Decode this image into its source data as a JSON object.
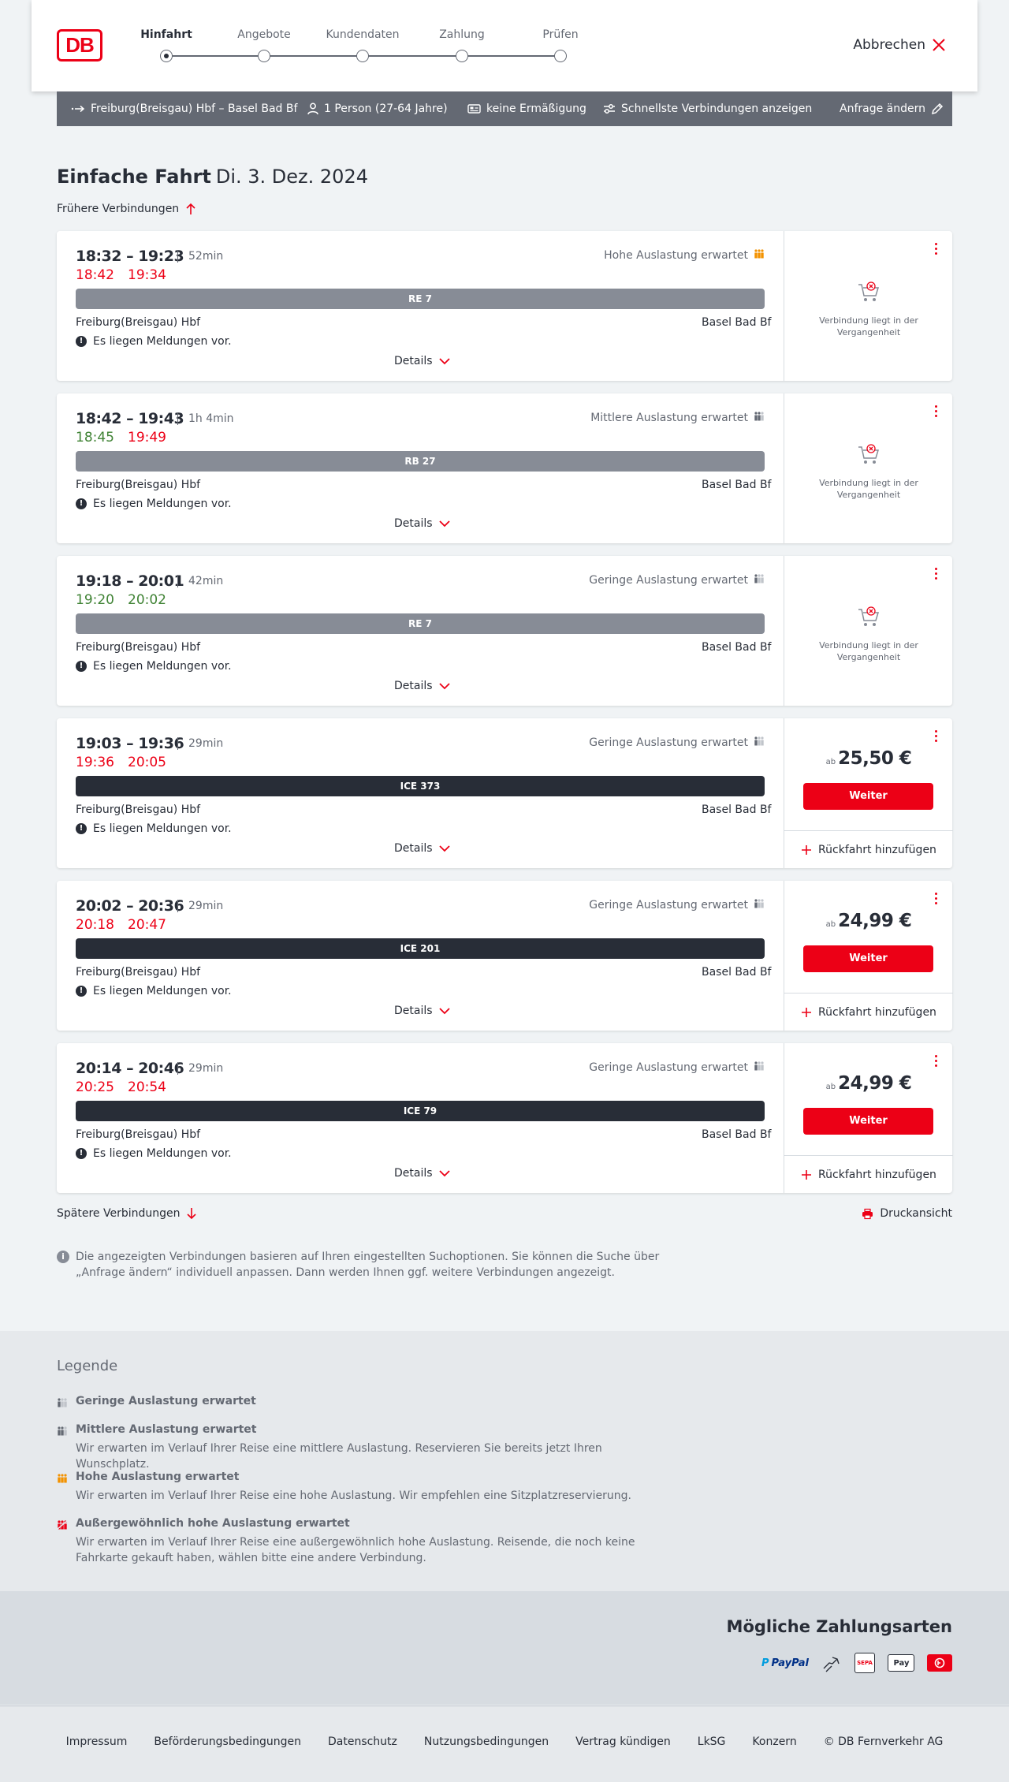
{
  "header": {
    "logo_text": "DB",
    "steps": [
      {
        "label": "Hinfahrt",
        "active": true
      },
      {
        "label": "Angebote",
        "active": false
      },
      {
        "label": "Kundendaten",
        "active": false
      },
      {
        "label": "Zahlung",
        "active": false
      },
      {
        "label": "Prüfen",
        "active": false
      }
    ],
    "cancel_label": "Abbrechen"
  },
  "summary": {
    "route": "Freiburg(Breisgau) Hbf – Basel Bad Bf",
    "passengers": "1 Person (27-64 Jahre)",
    "discount": "keine Ermäßigung",
    "fastest": "Schnellste Verbindungen anzeigen",
    "edit": "Anfrage ändern"
  },
  "main": {
    "title": "Einfache Fahrt",
    "date": "Di. 3. Dez. 2024",
    "earlier": "Frühere Verbindungen",
    "later": "Spätere Verbindungen",
    "print": "Druckansicht",
    "note": "Die angezeigten Verbindungen basieren auf Ihren eingestellten Suchoptionen. Sie können die Suche über „Anfrage ändern“ individuell anpassen. Dann werden Ihnen ggf. weitere Verbindungen angezeigt."
  },
  "connections": [
    {
      "times": "18:32 – 19:23",
      "duration": "52min",
      "rt_dep": "18:42",
      "rt_arr": "19:34",
      "rt_color": "red",
      "load": "Hohe Auslastung erwartet",
      "load_level": "high",
      "train": "RE 7",
      "bar": "grey",
      "from": "Freiburg(Breisgau) Hbf",
      "to": "Basel Bad Bf",
      "message": "Es liegen Meldungen vor.",
      "details": "Details",
      "past": true,
      "past_text": "Verbindung liegt in der Vergangenheit"
    },
    {
      "times": "18:42 – 19:43",
      "duration": "1h 4min",
      "rt_dep": "18:45",
      "rt_arr": "19:49",
      "rt_color": "mixed",
      "load": "Mittlere Auslastung erwartet",
      "load_level": "medium",
      "train": "RB 27",
      "bar": "grey",
      "from": "Freiburg(Breisgau) Hbf",
      "to": "Basel Bad Bf",
      "message": "Es liegen Meldungen vor.",
      "details": "Details",
      "past": true,
      "past_text": "Verbindung liegt in der Vergangenheit"
    },
    {
      "times": "19:18 – 20:01",
      "duration": "42min",
      "rt_dep": "19:20",
      "rt_arr": "20:02",
      "rt_color": "green",
      "load": "Geringe Auslastung erwartet",
      "load_level": "low",
      "train": "RE 7",
      "bar": "grey",
      "from": "Freiburg(Breisgau) Hbf",
      "to": "Basel Bad Bf",
      "message": "Es liegen Meldungen vor.",
      "details": "Details",
      "past": true,
      "past_text": "Verbindung liegt in der Vergangenheit"
    },
    {
      "times": "19:03 – 19:36",
      "duration": "29min",
      "rt_dep": "19:36",
      "rt_arr": "20:05",
      "rt_color": "red",
      "load": "Geringe Auslastung erwartet",
      "load_level": "low",
      "train": "ICE 373",
      "bar": "dark",
      "from": "Freiburg(Breisgau) Hbf",
      "to": "Basel Bad Bf",
      "message": "Es liegen Meldungen vor.",
      "details": "Details",
      "past": false,
      "price_prefix": "ab",
      "price": "25,50 €",
      "button": "Weiter",
      "return": "Rückfahrt hinzufügen"
    },
    {
      "times": "20:02 – 20:36",
      "duration": "29min",
      "rt_dep": "20:18",
      "rt_arr": "20:47",
      "rt_color": "red",
      "load": "Geringe Auslastung erwartet",
      "load_level": "low",
      "train": "ICE 201",
      "bar": "dark",
      "from": "Freiburg(Breisgau) Hbf",
      "to": "Basel Bad Bf",
      "message": "Es liegen Meldungen vor.",
      "details": "Details",
      "past": false,
      "price_prefix": "ab",
      "price": "24,99 €",
      "button": "Weiter",
      "return": "Rückfahrt hinzufügen"
    },
    {
      "times": "20:14 – 20:46",
      "duration": "29min",
      "rt_dep": "20:25",
      "rt_arr": "20:54",
      "rt_color": "red",
      "load": "Geringe Auslastung erwartet",
      "load_level": "low",
      "train": "ICE 79",
      "bar": "dark",
      "from": "Freiburg(Breisgau) Hbf",
      "to": "Basel Bad Bf",
      "message": "Es liegen Meldungen vor.",
      "details": "Details",
      "past": false,
      "price_prefix": "ab",
      "price": "24,99 €",
      "button": "Weiter",
      "return": "Rückfahrt hinzufügen"
    }
  ],
  "legend": {
    "title": "Legende",
    "items": [
      {
        "title": "Geringe Auslastung erwartet",
        "text": ""
      },
      {
        "title": "Mittlere Auslastung erwartet",
        "text": "Wir erwarten im Verlauf Ihrer Reise eine mittlere Auslastung. Reservieren Sie bereits jetzt Ihren Wunschplatz."
      },
      {
        "title": "Hohe Auslastung erwartet",
        "text": "Wir erwarten im Verlauf Ihrer Reise eine hohe Auslastung. Wir empfehlen eine Sitzplatzreservierung."
      },
      {
        "title": "Außergewöhnlich hohe Auslastung erwartet",
        "text": "Wir erwarten im Verlauf Ihrer Reise eine außergewöhnlich hohe Auslastung. Reisende, die noch keine Fahrkarte gekauft haben, wählen bitte eine andere Verbindung."
      }
    ]
  },
  "payment": {
    "title": "Mögliche Zahlungsarten",
    "paypal": "PayPal",
    "sepa": "SEPA",
    "applepay": "Pay"
  },
  "footer": {
    "links": [
      "Impressum",
      "Beförderungsbedingungen",
      "Datenschutz",
      "Nutzungsbedingungen",
      "Vertrag kündigen",
      "LkSG",
      "Konzern",
      "© DB Fernverkehr AG"
    ]
  },
  "colors": {
    "brand": "#ec0016",
    "delay": "#ec0016",
    "ontime": "#408335",
    "high_load": "#f39200",
    "dark": "#282d37",
    "grey_bar": "#878c96"
  }
}
